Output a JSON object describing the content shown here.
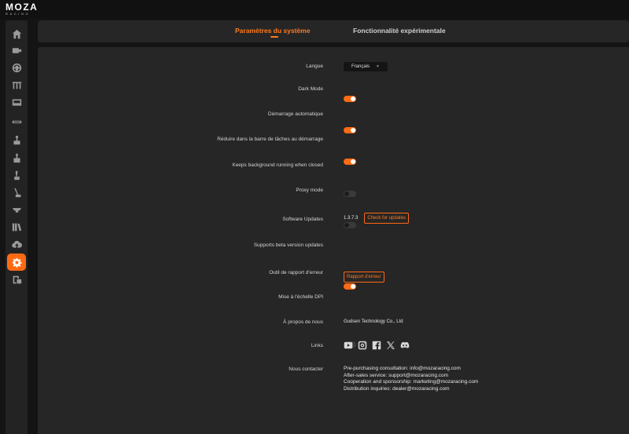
{
  "app": {
    "logo_main": "MOZA",
    "logo_sub": "RACING"
  },
  "sidebar": {
    "items": [
      {
        "icon": "home-icon"
      },
      {
        "icon": "wheelbase-icon"
      },
      {
        "icon": "steering-wheel-icon"
      },
      {
        "icon": "pedals-icon"
      },
      {
        "icon": "dashboard-icon"
      },
      {
        "icon": "dashboard-strip-icon"
      },
      {
        "icon": "shifter-icon"
      },
      {
        "icon": "sequential-shifter-icon"
      },
      {
        "icon": "handbrake-icon"
      },
      {
        "icon": "lever-icon"
      },
      {
        "icon": "hub-icon"
      },
      {
        "icon": "library-icon"
      },
      {
        "icon": "cloud-upload-icon"
      },
      {
        "icon": "settings-icon",
        "active": true
      },
      {
        "icon": "report-icon"
      }
    ]
  },
  "tabs": [
    {
      "label": "Paramètres du système",
      "active": true
    },
    {
      "label": "Fonctionnalité expérimentale",
      "active": false
    }
  ],
  "settings": {
    "language": {
      "label": "Langue",
      "value": "Français"
    },
    "dark_mode": {
      "label": "Dark Mode",
      "on": true
    },
    "autostart": {
      "label": "Démarrage automatique",
      "on": true
    },
    "minimize_tray": {
      "label": "Réduire dans la barre de tâches au démarrage",
      "on": true
    },
    "background_running": {
      "label": "Keeps background running when closed",
      "on": false
    },
    "proxy_mode": {
      "label": "Proxy mode",
      "on": false
    },
    "software_updates": {
      "label": "Software Updates",
      "version": "1.3.7.3",
      "button": "Check for updates"
    },
    "beta_updates": {
      "label": "Supports beta version updates",
      "on": true
    },
    "error_report": {
      "label": "Outil de rapport d'erreur",
      "button": "Rapport d'erreur"
    },
    "dpi_scaling": {
      "label": "Mise à l'échelle DPI",
      "on": false
    },
    "about": {
      "label": "À propos de nous",
      "value": "Gudsen Technology Co., Ltd"
    },
    "links": {
      "label": "Links",
      "icons": [
        "youtube-icon",
        "instagram-icon",
        "facebook-icon",
        "x-icon",
        "discord-icon"
      ]
    },
    "contact": {
      "label": "Nous contacter",
      "lines": [
        "Pre-purchasing consultation: info@mozaracing.com",
        "After-sales service: support@mozaracing.com",
        "Cooperation and sponsorship: marketing@mozaracing.com",
        "Distribution inquiries: dealer@mozaracing.com"
      ]
    }
  },
  "colors": {
    "accent": "#ff6a13",
    "panel": "#262626",
    "background": "#141414"
  }
}
